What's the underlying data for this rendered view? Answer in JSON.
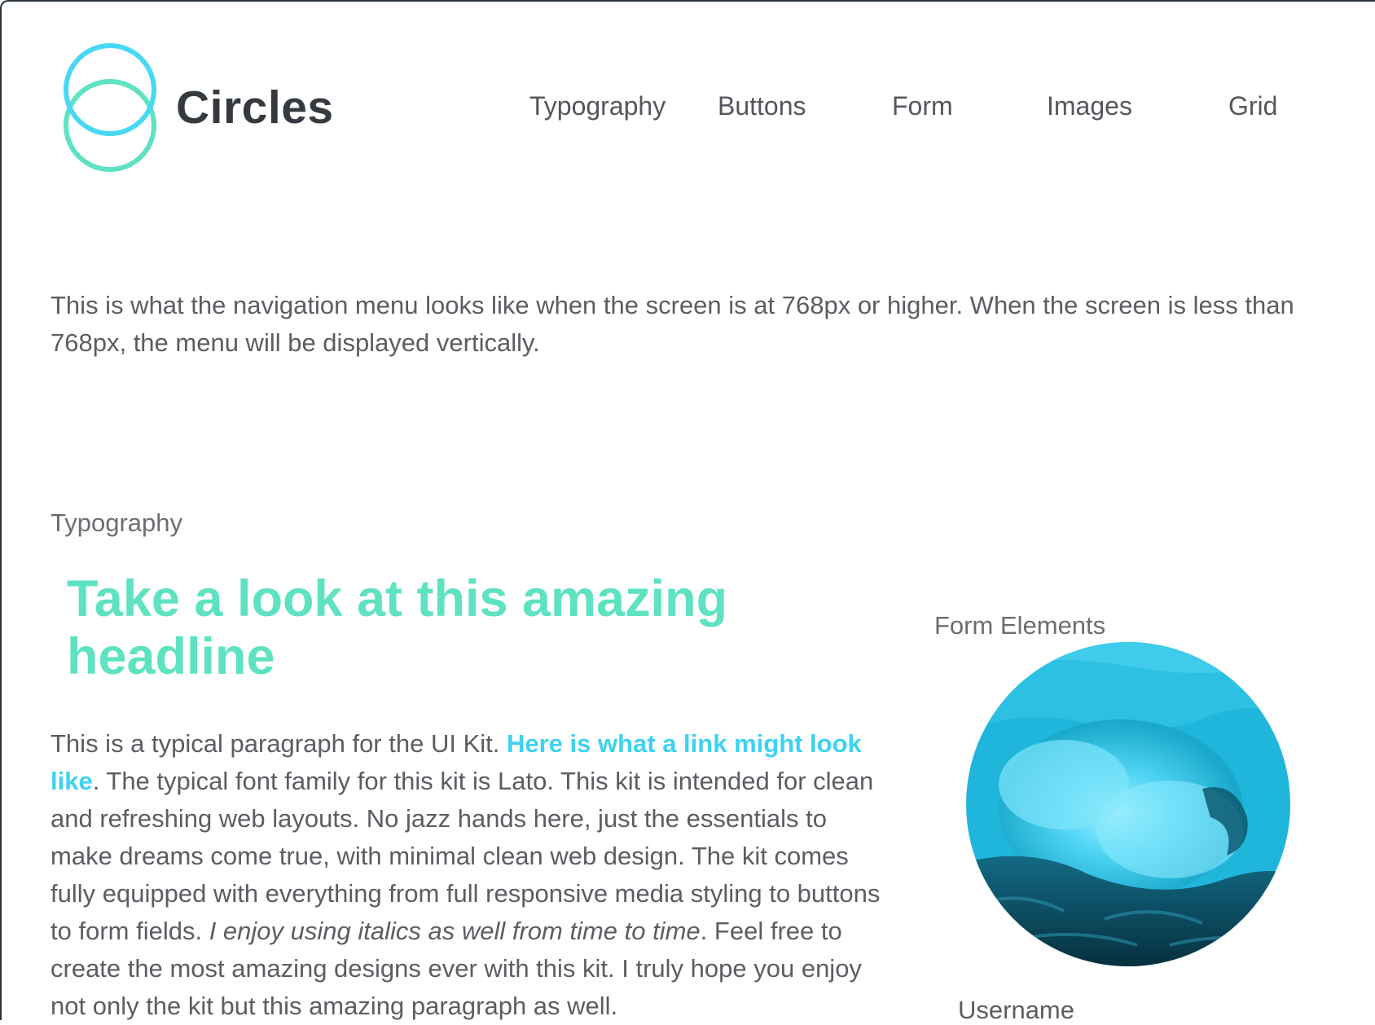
{
  "brand": {
    "name": "Circles"
  },
  "nav": {
    "items": [
      {
        "label": "Typography"
      },
      {
        "label": "Buttons"
      },
      {
        "label": "Form"
      },
      {
        "label": "Images"
      },
      {
        "label": "Grid"
      }
    ]
  },
  "intro": {
    "text": "This is what the navigation menu looks like when the screen is at 768px or higher. When the screen is less than 768px, the menu will be displayed vertically."
  },
  "typography": {
    "label": "Typography",
    "headline": "Take a look at this amazing headline",
    "paragraph": {
      "text_before_link": "This is a typical paragraph for the UI Kit. ",
      "link_text": "Here is what a link might look like",
      "text_after_link": ". The typical font family for this kit is Lato. This kit is intended for clean and refreshing web layouts. No jazz hands here, just the essentials to make dreams come true, with minimal clean web design. The kit comes fully equipped with everything from full responsive media styling to buttons to form fields. ",
      "italic_text": "I enjoy using italics as well from time to time",
      "text_end": ". Feel free to create the most amazing designs ever with this kit. I truly hope you enjoy not only the kit but this amazing paragraph as well."
    }
  },
  "form": {
    "label": "Form Elements",
    "username_label": "Username"
  },
  "colors": {
    "accent_green": "#5ee2c1",
    "accent_blue": "#3dd2f2",
    "text": "#5a5e63",
    "logo_text": "#353a40"
  },
  "icons": {
    "logo": "two-overlapping-circles-logo",
    "image": "ocean-wave-circle-image"
  }
}
